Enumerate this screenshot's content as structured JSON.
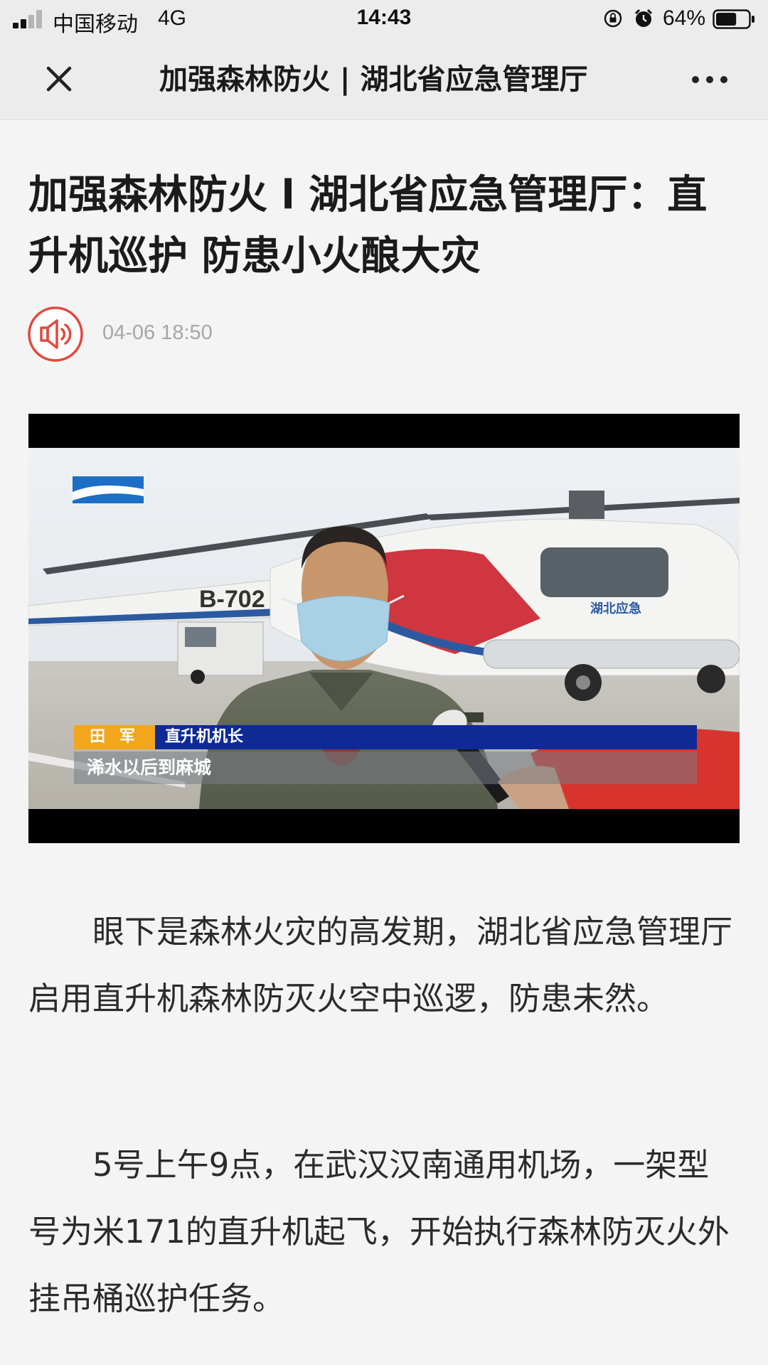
{
  "status_bar": {
    "carrier": "中国移动",
    "network": "4G",
    "time": "14:43",
    "battery": "64%",
    "battery_level": 0.64,
    "icons": [
      "signal-icon",
      "orientation-lock-icon",
      "alarm-icon",
      "battery-icon"
    ]
  },
  "nav": {
    "title": "加强森林防火 | 湖北省应急管理厅",
    "close_icon": "close-icon",
    "more_icon": "more-icon"
  },
  "article": {
    "title": "加强森林防火 l 湖北省应急管理厅：直升机巡护 防患小火酿大灾",
    "date": "04-06 18:50",
    "audio_icon": "speaker-icon",
    "video": {
      "aircraft_reg": "B-702",
      "caption_name": "田 军",
      "caption_role": "直升机机长",
      "subtitle": "浠水以后到麻城"
    },
    "paragraphs": [
      "眼下是森林火灾的高发期，湖北省应急管理厅启用直升机森林防灭火空中巡逻，防患未然。",
      "5号上午9点，在武汉汉南通用机场，一架型号为米171的直升机起飞，开始执行森林防灭火外挂吊桶巡护任务。"
    ]
  },
  "colors": {
    "accent_red": "#e2483d",
    "caption_orange": "#f3a51c",
    "caption_blue": "#0f2a95",
    "date_gray": "#a6a6a6"
  }
}
